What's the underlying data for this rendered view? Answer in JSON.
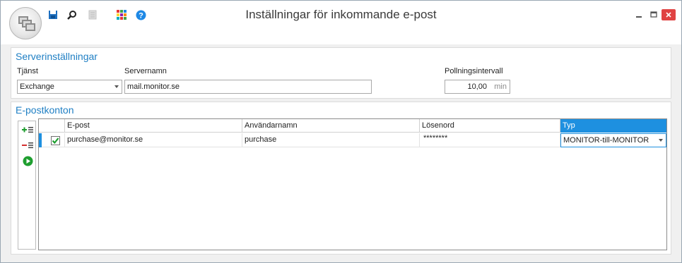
{
  "window": {
    "title": "Inställningar för inkommande e-post",
    "toolbar_icons": [
      "save-icon",
      "search-icon",
      "document-icon",
      "apps-grid-icon",
      "help-icon"
    ],
    "controls": [
      "minimize-icon",
      "maximize-icon",
      "close-icon"
    ]
  },
  "server": {
    "section_title": "Serverinställningar",
    "service_label": "Tjänst",
    "service_value": "Exchange",
    "servername_label": "Servernamn",
    "servername_value": "mail.monitor.se",
    "polling_label": "Pollningsintervall",
    "polling_value": "10,00",
    "polling_unit": "min"
  },
  "accounts": {
    "section_title": "E-postkonton",
    "toolbar": [
      "add-row-icon",
      "remove-row-icon",
      "play-icon"
    ],
    "columns": [
      "E-post",
      "Användarnamn",
      "Lösenord",
      "Typ"
    ],
    "rows": [
      {
        "checked": true,
        "email": "purchase@monitor.se",
        "username": "purchase",
        "password": "********",
        "type": "MONITOR-till-MONITOR"
      }
    ]
  },
  "colors": {
    "accent": "#1e90e0",
    "section_title": "#1f7fc4",
    "close_button": "#e04343"
  }
}
